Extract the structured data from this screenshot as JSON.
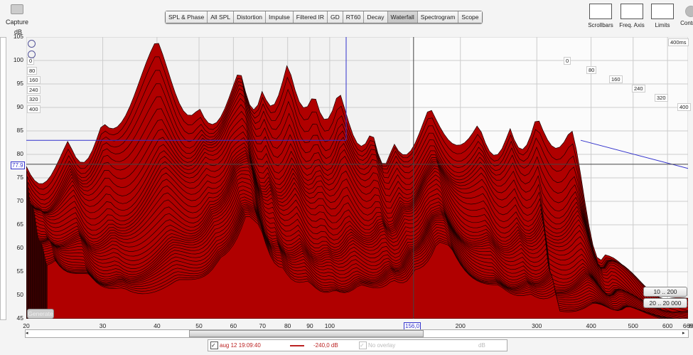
{
  "toolbar": {
    "capture": "Capture",
    "tabs": [
      "SPL & Phase",
      "All SPL",
      "Distortion",
      "Impulse",
      "Filtered IR",
      "GD",
      "RT60",
      "Decay",
      "Waterfall",
      "Spectrogram",
      "Scope"
    ],
    "active_tab": "Waterfall",
    "tools": [
      "Scrollbars",
      "Freq. Axis",
      "Limits",
      "Controls"
    ]
  },
  "plot": {
    "y_unit": "dB",
    "time_end_label": "400ms",
    "time_labels": [
      "0",
      "80",
      "160",
      "240",
      "320",
      "400"
    ],
    "cursor_db": "77.9",
    "cursor_freq": "156,0",
    "generate": "Generate",
    "range_buttons": [
      "10 .. 200",
      "20 .. 20 000"
    ],
    "x_unit": "H"
  },
  "chart_data": {
    "type": "waterfall",
    "title": "Waterfall",
    "ylabel": "dB",
    "ylim": [
      45,
      105
    ],
    "yticks": [
      45,
      50,
      55,
      60,
      65,
      70,
      75,
      80,
      85,
      90,
      95,
      100,
      105
    ],
    "xlim": [
      20,
      669
    ],
    "xscale": "log",
    "xticks": [
      "20",
      "30",
      "40",
      "50",
      "60",
      "70",
      "80",
      "90",
      "100",
      "200",
      "300",
      "400",
      "500",
      "600",
      "669"
    ],
    "time_range_ms": [
      0,
      400
    ],
    "slices": 40,
    "peaks_0ms": [
      [
        20,
        76
      ],
      [
        25,
        84
      ],
      [
        30,
        88
      ],
      [
        40,
        103
      ],
      [
        50,
        91
      ],
      [
        62,
        99
      ],
      [
        70,
        93
      ],
      [
        80,
        98
      ],
      [
        92,
        93
      ],
      [
        105,
        95
      ],
      [
        125,
        86
      ],
      [
        140,
        82
      ],
      [
        170,
        89
      ],
      [
        220,
        88
      ],
      [
        260,
        86
      ],
      [
        300,
        87
      ],
      [
        360,
        85
      ],
      [
        430,
        60
      ],
      [
        600,
        48
      ]
    ],
    "floor_db": 45,
    "color": "#b00000"
  },
  "legend": {
    "measurement": "aug 12 19:09:40",
    "level": "-240,0 dB",
    "overlay": "No overlay",
    "unit": "dB"
  }
}
